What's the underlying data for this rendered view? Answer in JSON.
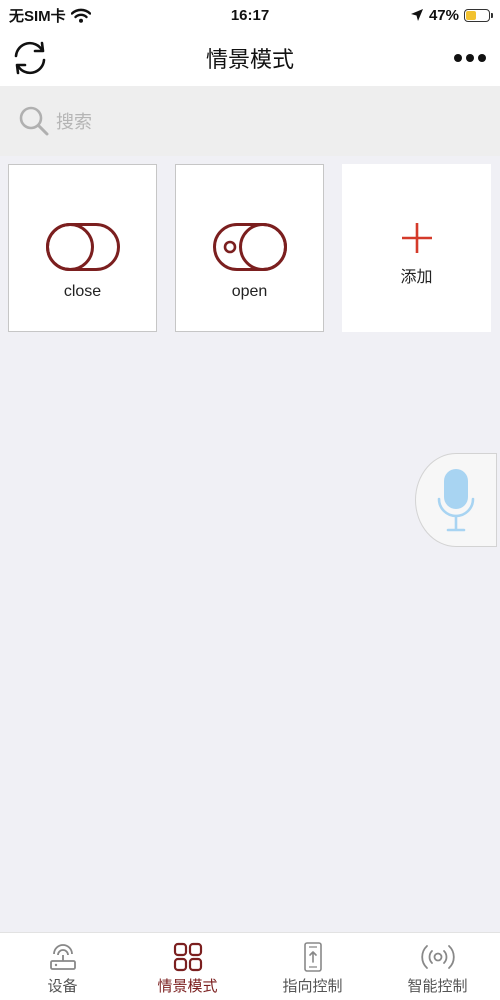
{
  "status_bar": {
    "carrier": "无SIM卡",
    "time": "16:17",
    "battery_percent": "47%",
    "battery_level": 0.47
  },
  "nav": {
    "title": "情景模式"
  },
  "search": {
    "placeholder": "搜索"
  },
  "scenes": [
    {
      "label": "close",
      "icon": "toggle-off-icon"
    },
    {
      "label": "open",
      "icon": "toggle-on-icon"
    },
    {
      "label": "添加",
      "icon": "plus-icon"
    }
  ],
  "tabs": [
    {
      "label": "设备",
      "icon": "router-icon",
      "active": false
    },
    {
      "label": "情景模式",
      "icon": "grid-icon",
      "active": true
    },
    {
      "label": "指向控制",
      "icon": "phone-pointer-icon",
      "active": false
    },
    {
      "label": "智能控制",
      "icon": "signal-icon",
      "active": false
    }
  ],
  "colors": {
    "accent": "#7b1f1f",
    "add_plus": "#d43a2a",
    "mic": "#a8d4f2",
    "background": "#f0f0f5"
  }
}
